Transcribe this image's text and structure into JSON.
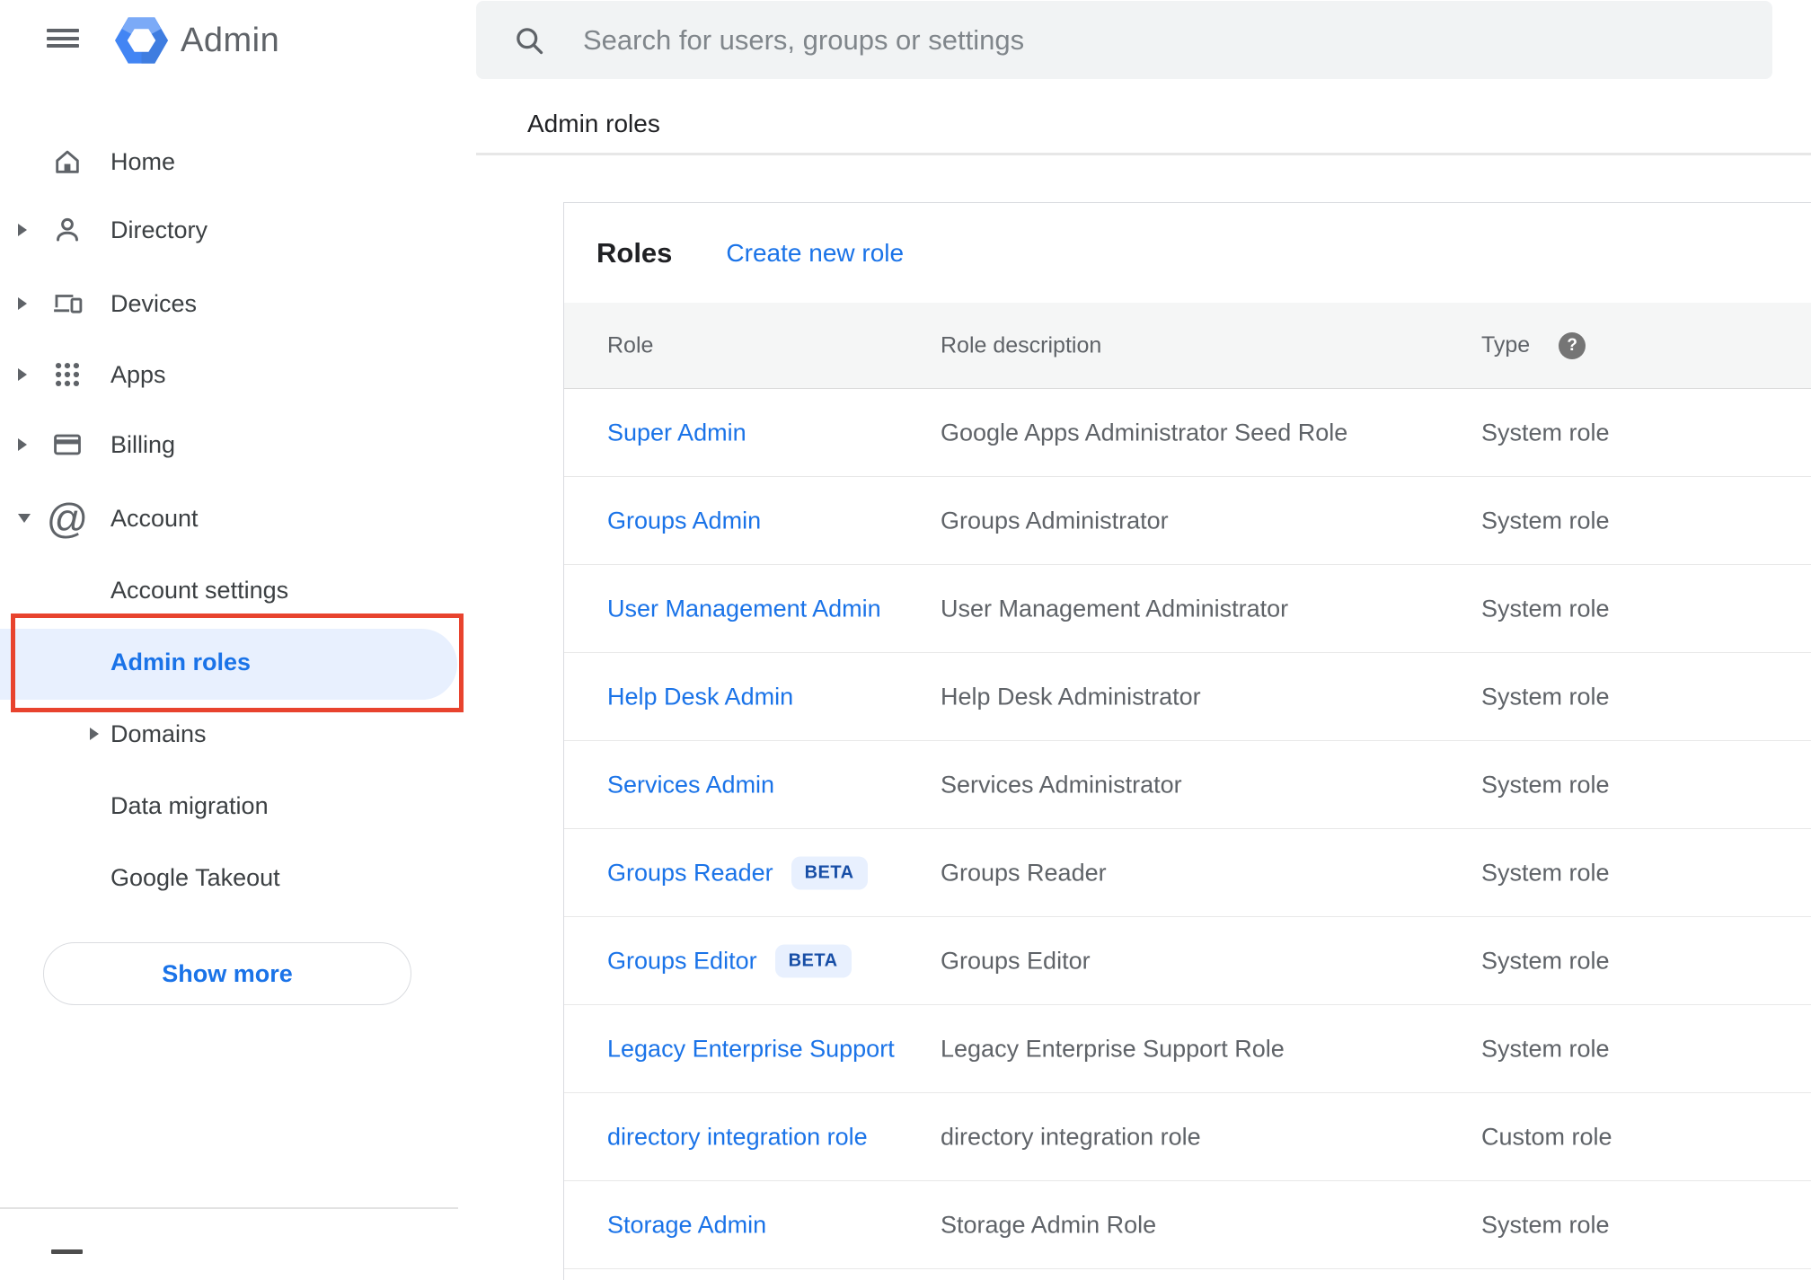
{
  "app": {
    "name": "Admin"
  },
  "sidebar": {
    "items": [
      {
        "label": "Home",
        "icon": "home-icon",
        "expandable": false
      },
      {
        "label": "Directory",
        "icon": "person-icon",
        "expandable": true
      },
      {
        "label": "Devices",
        "icon": "devices-icon",
        "expandable": true
      },
      {
        "label": "Apps",
        "icon": "apps-grid-icon",
        "expandable": true
      },
      {
        "label": "Billing",
        "icon": "credit-card-icon",
        "expandable": true
      },
      {
        "label": "Account",
        "icon": "at-sign-icon",
        "expanded": true
      }
    ],
    "account_children": [
      {
        "label": "Account settings",
        "selected": false
      },
      {
        "label": "Admin roles",
        "selected": true
      },
      {
        "label": "Domains",
        "expandable": true,
        "selected": false
      },
      {
        "label": "Data migration",
        "selected": false
      },
      {
        "label": "Google Takeout",
        "selected": false
      }
    ],
    "show_more_label": "Show more"
  },
  "search": {
    "placeholder": "Search for users, groups or settings"
  },
  "breadcrumb": {
    "label": "Admin roles"
  },
  "roles_card": {
    "title": "Roles",
    "create_link_label": "Create new role",
    "columns": {
      "role": "Role",
      "description": "Role description",
      "type": "Type"
    },
    "beta_label": "BETA",
    "rows": [
      {
        "role": "Super Admin",
        "description": "Google Apps Administrator Seed Role",
        "type": "System role",
        "beta": false
      },
      {
        "role": "Groups Admin",
        "description": "Groups Administrator",
        "type": "System role",
        "beta": false
      },
      {
        "role": "User Management Admin",
        "description": "User Management Administrator",
        "type": "System role",
        "beta": false
      },
      {
        "role": "Help Desk Admin",
        "description": "Help Desk Administrator",
        "type": "System role",
        "beta": false
      },
      {
        "role": "Services Admin",
        "description": "Services Administrator",
        "type": "System role",
        "beta": false
      },
      {
        "role": "Groups Reader",
        "description": "Groups Reader",
        "type": "System role",
        "beta": true
      },
      {
        "role": "Groups Editor",
        "description": "Groups Editor",
        "type": "System role",
        "beta": true
      },
      {
        "role": "Legacy Enterprise Support",
        "description": "Legacy Enterprise Support Role",
        "type": "System role",
        "beta": false
      },
      {
        "role": "directory integration role",
        "description": "directory integration role",
        "type": "Custom role",
        "beta": false
      },
      {
        "role": "Storage Admin",
        "description": "Storage Admin Role",
        "type": "System role",
        "beta": false
      }
    ]
  },
  "glyphs": {
    "at": "@",
    "help": "?"
  },
  "colors": {
    "accent": "#1a73e8",
    "selected_bg": "#e8f0fe",
    "annotation_red": "#e8432e",
    "beta_bg": "#e8f0fe",
    "beta_text": "#174ea6",
    "search_bg": "#f1f3f4",
    "table_header_bg": "#f5f6f6"
  }
}
